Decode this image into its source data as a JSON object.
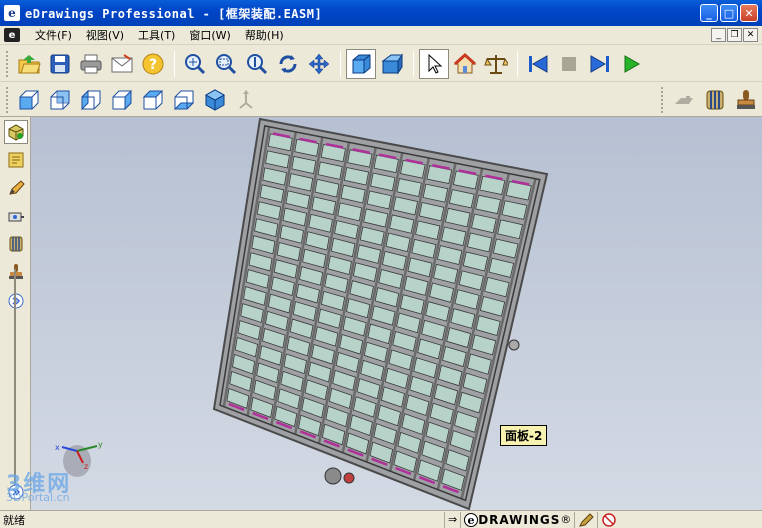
{
  "window": {
    "title": "eDrawings Professional - [框架装配.EASM]",
    "app_icon": "e",
    "controls": [
      "minimize",
      "maximize",
      "close"
    ]
  },
  "menubar": {
    "mdi_icon": "e",
    "items": [
      {
        "label": "文件(F)"
      },
      {
        "label": "视图(V)"
      },
      {
        "label": "工具(T)"
      },
      {
        "label": "窗口(W)"
      },
      {
        "label": "帮助(H)"
      }
    ]
  },
  "toolbar1": {
    "buttons": [
      "open-icon",
      "save-icon",
      "print-icon",
      "email-icon",
      "help-icon",
      "zoom-fit-icon",
      "zoom-area-icon",
      "zoom-in-icon",
      "rotate-icon",
      "pan-icon",
      "shaded-view-icon",
      "perspective-icon",
      "select-icon",
      "home-icon",
      "measure-icon",
      "first-frame-icon",
      "stop-icon",
      "next-frame-icon",
      "play-icon"
    ]
  },
  "toolbar2": {
    "buttons": [
      "view-front-icon",
      "view-back-icon",
      "view-left-icon",
      "view-right-icon",
      "view-top-icon",
      "view-bottom-icon",
      "view-iso-icon",
      "view-trimetric-icon",
      "markup-icon",
      "section-icon",
      "stamp-icon"
    ]
  },
  "leftbar": {
    "buttons": [
      "components-icon",
      "configurations-icon",
      "markup-pen-icon",
      "measure-tape-icon",
      "section-tool-icon",
      "stamp-tool-icon",
      "expand-icon",
      "collapse-icon"
    ]
  },
  "viewport": {
    "tooltip": "面板-2",
    "triad_axes": [
      "x",
      "y",
      "z"
    ]
  },
  "statusbar": {
    "text": "就绪",
    "brand": "DRAWINGS",
    "brand_prefix": "e",
    "registered": "®"
  },
  "watermark": {
    "line1": "3维网",
    "line2": "3DPortal.cn"
  },
  "colors": {
    "titlebar": "#0046c8",
    "background": "#ece9d8",
    "viewport_top": "#b6c0d2",
    "panel_glass": "#b7d2c8",
    "frame_steel": "#6a6a6a",
    "accent_magenta": "#b0309a",
    "tooltip_bg": "#f8f2b0"
  }
}
